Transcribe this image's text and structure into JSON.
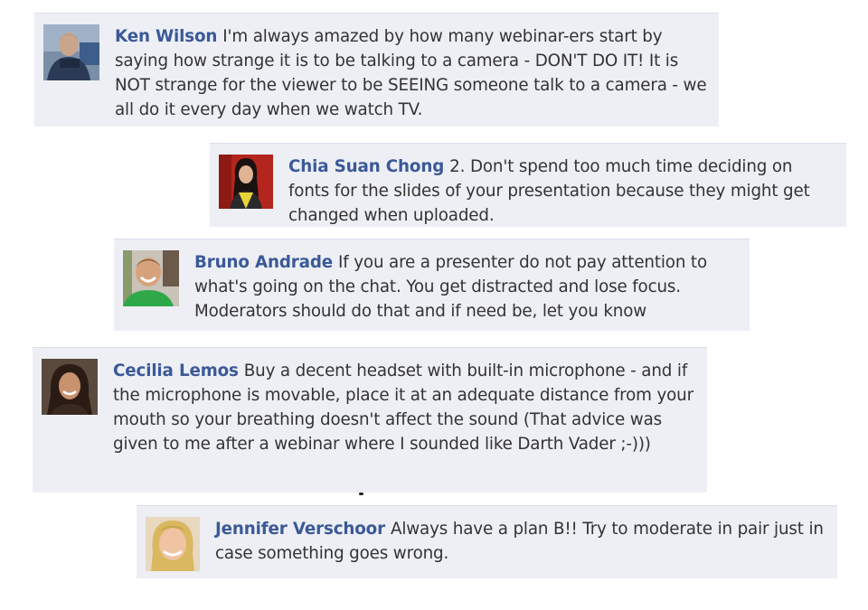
{
  "comments": [
    {
      "author": "Ken Wilson",
      "text": "I'm always amazed by how many webinar-ers start by saying how strange it is to be talking to a camera - DON'T DO IT! It is NOT strange for the viewer to be SEEING someone talk to a camera - we all do it every day when we watch TV."
    },
    {
      "author": "Chia Suan Chong",
      "text": "2. Don't spend too much time deciding on fonts for the slides of your presentation because they might get changed when uploaded."
    },
    {
      "author": "Bruno Andrade",
      "text": "If you are a presenter do not pay attention to what's going on the chat. You get distracted and lose focus. Moderators should do that and if need be, let you know"
    },
    {
      "author": "Cecilia Lemos",
      "text": "Buy a decent headset with built-in microphone - and if the microphone is movable, place it at an adequate distance from your mouth so your breathing doesn't affect the sound (That advice was given to me after a webinar where I sounded like Darth Vader ;-)))"
    },
    {
      "author": "Jennifer Verschoor",
      "text": "Always have a plan B!! Try to moderate in pair just in case something goes wrong."
    }
  ],
  "colors": {
    "author_link": "#3b5998",
    "comment_background": "#edeff4",
    "text": "#333333"
  }
}
